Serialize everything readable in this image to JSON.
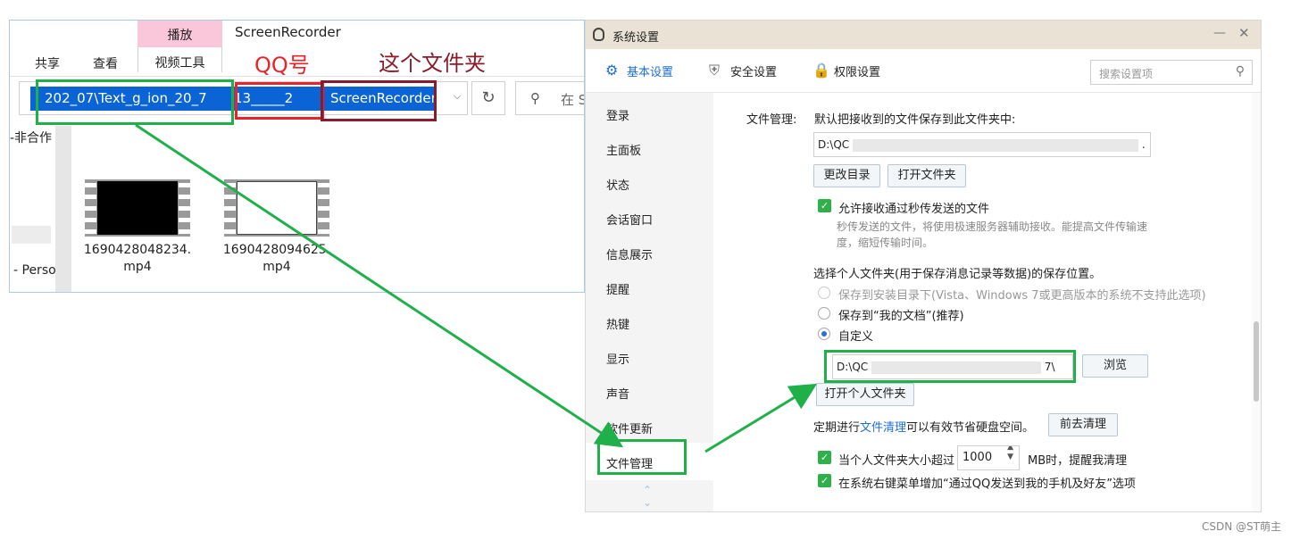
{
  "explorer": {
    "tabs": {
      "share": "共享",
      "view": "查看",
      "play": "播放",
      "video_tools": "视频工具"
    },
    "window_title": "ScreenRecorder",
    "address": {
      "seg1": "202_07\\Text_g_ion_20_7",
      "seg2": "13_____2",
      "seg3": "ScreenRecorder"
    },
    "search_placeholder": "在 S",
    "nav": {
      "item1": "-非合作",
      "item2": "- Perso"
    },
    "files": [
      {
        "name": "1690428048234.mp4"
      },
      {
        "name": "1690428094625.mp4"
      }
    ]
  },
  "annotations": {
    "qq_number": "QQ号",
    "this_folder": "这个文件夹",
    "colors": {
      "green": "#1fb04a",
      "red": "#e8232a",
      "darkred": "#8b1a2a"
    }
  },
  "qq": {
    "window_title": "系统设置",
    "tabs": {
      "basic": "基本设置",
      "security": "安全设置",
      "permission": "权限设置"
    },
    "search_placeholder": "搜索设置项",
    "sidebar": [
      "登录",
      "主面板",
      "状态",
      "会话窗口",
      "信息展示",
      "提醒",
      "热键",
      "显示",
      "声音",
      "软件更新",
      "文件管理"
    ],
    "file_mgmt": {
      "section_label": "文件管理:",
      "default_folder_text": "默认把接收到的文件保存到此文件夹中:",
      "path_prefix": "D:\\QC",
      "path_suffix": ".",
      "change_dir": "更改目录",
      "open_folder": "打开文件夹",
      "allow_fast": "允许接收通过秒传发送的文件",
      "fast_desc_1": "秒传发送的文件，将使用极速服务器辅助接收。能提高文件传输速",
      "fast_desc_2": "度，缩短传输时间。",
      "personal_folder_text": "选择个人文件夹(用于保存消息记录等数据)的保存位置。",
      "opt_install": "保存到安装目录下(Vista、Windows 7或更高版本的系统不支持此选项)",
      "opt_mydocs": "保存到“我的文档”(推荐)",
      "opt_custom": "自定义",
      "custom_path_prefix": "D:\\QC",
      "custom_path_suffix": "7\\",
      "browse": "浏览",
      "open_personal": "打开个人文件夹",
      "cleanup_pre": "定期进行",
      "cleanup_link": "文件清理",
      "cleanup_post": "可以有效节省硬盘空间。",
      "go_cleanup": "前去清理",
      "size_pre": "当个人文件夹大小超过",
      "size_value": "1000",
      "size_post": "MB时，提醒我清理",
      "context_menu": "在系统右键菜单增加“通过QQ发送到我的手机及好友”选项"
    }
  },
  "watermark": "CSDN @ST萌主"
}
